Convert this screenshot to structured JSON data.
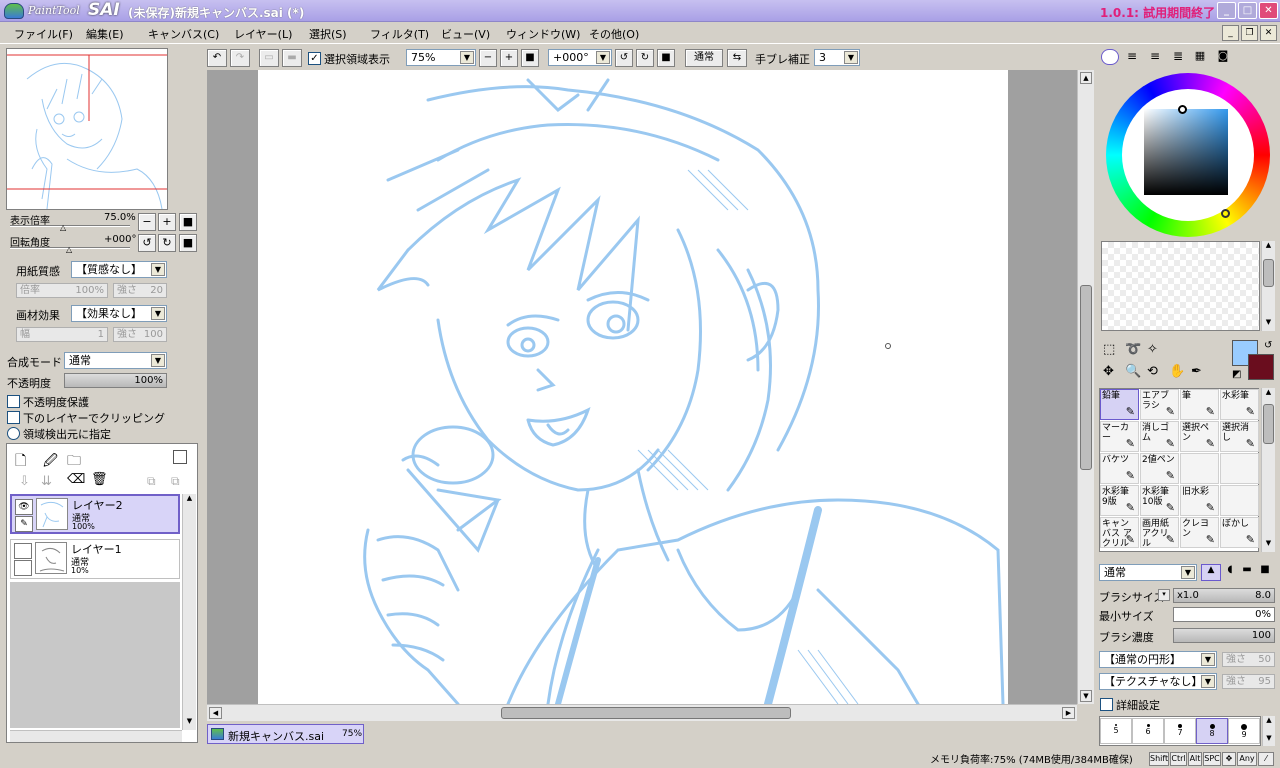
{
  "app": {
    "logo_text": "PaintTool",
    "logo_sai": "SAI",
    "doc_title": "(未保存)新規キャンバス.sai (*)",
    "version": "1.0.1: 試用期間終了"
  },
  "menu": [
    "ファイル(F)",
    "編集(E)",
    "キャンバス(C)",
    "レイヤー(L)",
    "選択(S)",
    "フィルタ(T)",
    "ビュー(V)",
    "ウィンドウ(W)",
    "その他(O)"
  ],
  "window_buttons": {
    "min": "_",
    "max": "□",
    "close": "✕",
    "restore": "❐"
  },
  "navigator": {
    "zoom_label": "表示倍率",
    "zoom_value": "75.0%",
    "rotate_label": "回転角度",
    "rotate_value": "+000°",
    "btn_minus": "−",
    "btn_plus": "+",
    "btn_reset": "■",
    "btn_rot_left": "↺",
    "btn_rot_right": "↻"
  },
  "paper": {
    "texture_label": "用紙質感",
    "texture_value": "【質感なし】",
    "scale_label": "倍率",
    "scale_value": "100%",
    "strength_label": "強さ",
    "strength_value": "20",
    "effect_label": "画材効果",
    "effect_value": "【効果なし】",
    "width_label": "幅",
    "width_value": "1",
    "effect_strength_label": "強さ",
    "effect_strength_value": "100"
  },
  "blend": {
    "mode_label": "合成モード",
    "mode_value": "通常",
    "opacity_label": "不透明度",
    "opacity_value": "100%",
    "opacity_fill": 1.0
  },
  "checkboxes": {
    "protect_alpha": "不透明度保護",
    "clipping": "下のレイヤーでクリッピング",
    "selection_source": "領域検出元に指定"
  },
  "layers": [
    {
      "name": "レイヤー2",
      "mode": "通常",
      "opacity": "100%",
      "selected": true,
      "visible": true
    },
    {
      "name": "レイヤー1",
      "mode": "通常",
      "opacity": "10%",
      "selected": false,
      "visible": false
    }
  ],
  "toolbar": {
    "show_selection": "選択領域表示",
    "zoom_value": "75%",
    "angle_value": "+000°",
    "blend_value": "通常",
    "stabilizer_label": "手ブレ補正",
    "stabilizer_value": "3"
  },
  "tabs": [
    {
      "name": "新規キャンバス.sai",
      "zoom": "75%"
    }
  ],
  "tools": [
    {
      "name": "鉛筆",
      "selected": true
    },
    {
      "name": "エアブラシ",
      "selected": false
    },
    {
      "name": "筆",
      "selected": false
    },
    {
      "name": "水彩筆",
      "selected": false
    },
    {
      "name": "マーカー",
      "selected": false
    },
    {
      "name": "消しゴム",
      "selected": false
    },
    {
      "name": "選択ペン",
      "selected": false
    },
    {
      "name": "選択消し",
      "selected": false
    },
    {
      "name": "バケツ",
      "selected": false
    },
    {
      "name": "2値ペン",
      "selected": false
    },
    {
      "name": "",
      "selected": false
    },
    {
      "name": "",
      "selected": false
    },
    {
      "name": "水彩筆 9版",
      "selected": false
    },
    {
      "name": "水彩筆 10版",
      "selected": false
    },
    {
      "name": "旧水彩",
      "selected": false
    },
    {
      "name": "",
      "selected": false
    },
    {
      "name": "キャンバス アクリル",
      "selected": false
    },
    {
      "name": "画用紙 アクリル",
      "selected": false
    },
    {
      "name": "クレヨン",
      "selected": false
    },
    {
      "name": "ぼかし",
      "selected": false
    }
  ],
  "brush": {
    "mode_value": "通常",
    "size_label": "ブラシサイズ",
    "size_multiplier": "x1.0",
    "size_value": "8.0",
    "min_size_label": "最小サイズ",
    "min_size_value": "0%",
    "density_label": "ブラシ濃度",
    "density_value": "100",
    "shape_value": "【通常の円形】",
    "shape_strength_label": "強さ",
    "shape_strength_value": "50",
    "texture_value": "【テクスチャなし】",
    "texture_strength_label": "強さ",
    "texture_strength_value": "95",
    "detail_label": "詳細設定",
    "presets": [
      "5",
      "6",
      "7",
      "8",
      "9"
    ],
    "selected_preset": "8"
  },
  "colors": {
    "foreground": "#99ccff",
    "background": "#6a0d1e",
    "accent": "#7060c8",
    "sketch": "#9ac8f0"
  },
  "status": {
    "memory": "メモリ負荷率:75% (74MB使用/384MB確保)",
    "keys": [
      "Shift",
      "Ctrl",
      "Alt",
      "SPC",
      "✥",
      "Any",
      "⁄"
    ]
  }
}
